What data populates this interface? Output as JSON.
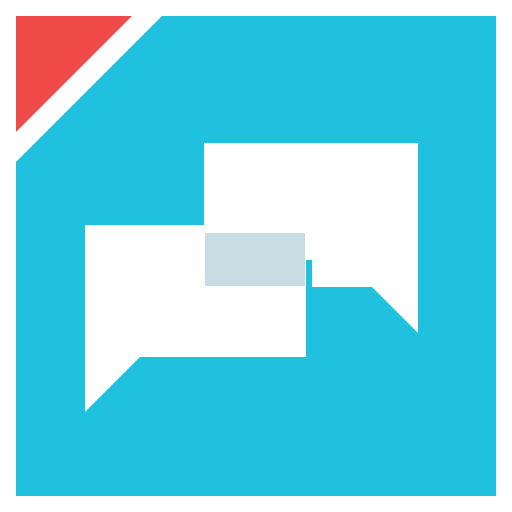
{
  "icon": {
    "name": "chat-bubbles-app-icon",
    "colors": {
      "background": "#1fc1df",
      "corner_accent": "#ef4a48",
      "bubble": "#ffffff",
      "overlap": "#c7dde3",
      "page": "#ffffff"
    }
  }
}
